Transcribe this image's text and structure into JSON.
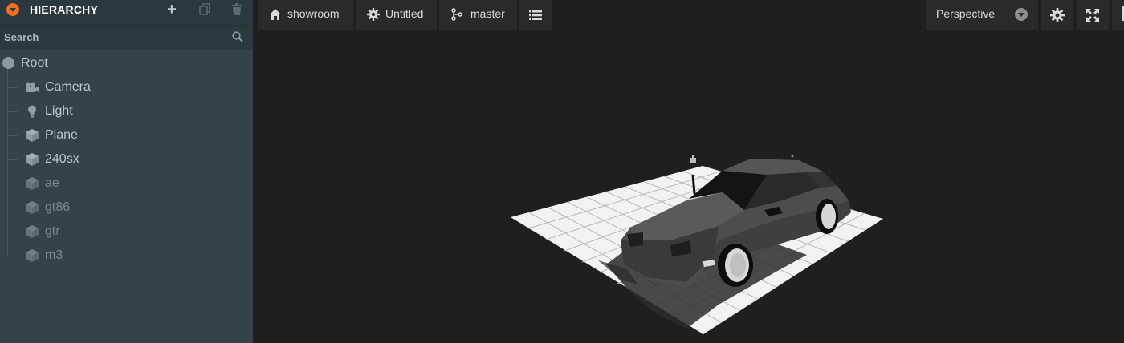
{
  "hierarchy": {
    "title": "HIERARCHY",
    "search_label": "Search",
    "root": {
      "label": "Root"
    },
    "items": [
      {
        "label": "Camera",
        "icon": "camera-icon",
        "enabled": true
      },
      {
        "label": "Light",
        "icon": "lightbulb-icon",
        "enabled": true
      },
      {
        "label": "Plane",
        "icon": "cube-icon",
        "enabled": true
      },
      {
        "label": "240sx",
        "icon": "cube-icon",
        "enabled": true
      },
      {
        "label": "ae",
        "icon": "cube-icon",
        "enabled": false
      },
      {
        "label": "gt86",
        "icon": "cube-icon",
        "enabled": false
      },
      {
        "label": "gtr",
        "icon": "cube-icon",
        "enabled": false
      },
      {
        "label": "m3",
        "icon": "cube-icon",
        "enabled": false
      }
    ]
  },
  "toolbar": {
    "project": "showroom",
    "scene": "Untitled",
    "branch": "master",
    "camera_mode": "Perspective"
  },
  "colors": {
    "accent": "#f26d21",
    "panel": "#364346",
    "viewport": "#1f1f1f"
  }
}
